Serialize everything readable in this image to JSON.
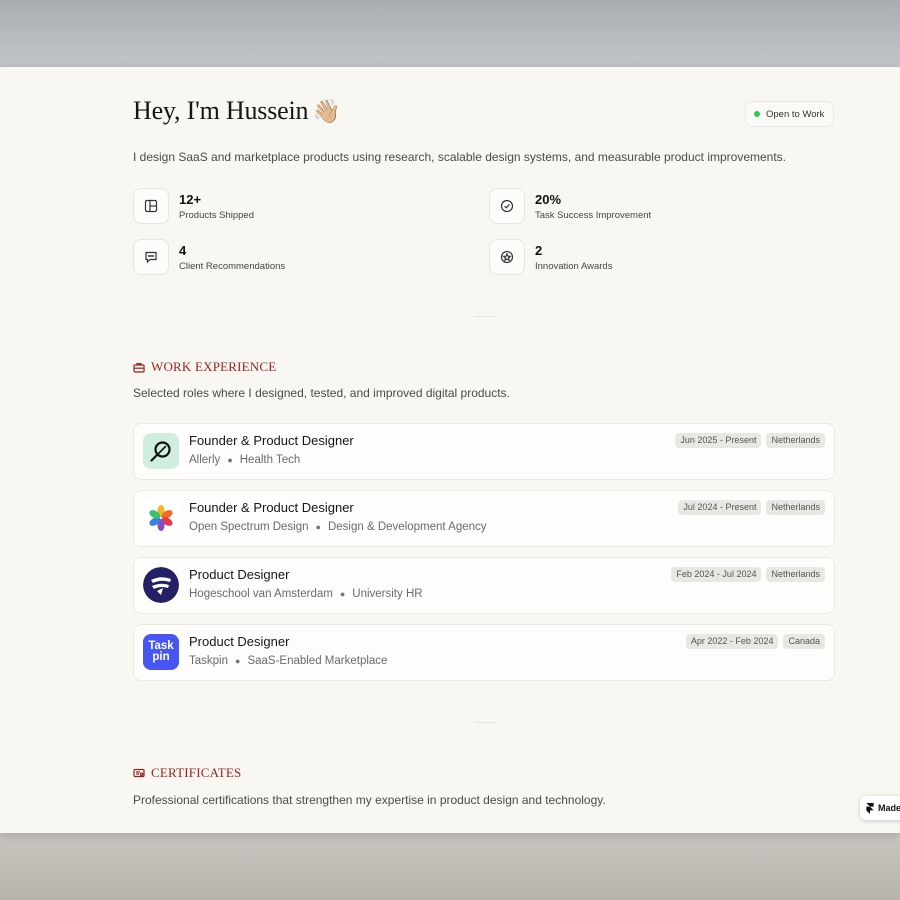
{
  "hero": {
    "greeting": "Hey, I'm Hussein",
    "emoji": "👋🏼",
    "status": "Open to Work",
    "intro": "I design SaaS and marketplace products using research, scalable design systems, and measurable product improvements."
  },
  "stats": [
    {
      "value": "12+",
      "label": "Products Shipped",
      "icon": "layout-icon"
    },
    {
      "value": "20%",
      "label": "Task Success Improvement",
      "icon": "check-circle-icon"
    },
    {
      "value": "4",
      "label": "Client Recommendations",
      "icon": "message-icon"
    },
    {
      "value": "2",
      "label": "Innovation Awards",
      "icon": "award-icon"
    }
  ],
  "work": {
    "heading": "WORK EXPERIENCE",
    "subtitle": "Selected roles where I designed, tested, and improved digital products.",
    "items": [
      {
        "role": "Founder & Product Designer",
        "company": "Allerly",
        "category": "Health Tech",
        "dates": "Jun 2025 - Present",
        "location": "Netherlands",
        "logo": "allerly-logo"
      },
      {
        "role": "Founder & Product Designer",
        "company": "Open Spectrum Design",
        "category": "Design & Development Agency",
        "dates": "Jul 2024 - Present",
        "location": "Netherlands",
        "logo": "open-spectrum-logo"
      },
      {
        "role": "Product Designer",
        "company": "Hogeschool van Amsterdam",
        "category": "University HR",
        "dates": "Feb 2024 - Jul 2024",
        "location": "Netherlands",
        "logo": "hva-logo"
      },
      {
        "role": "Product Designer",
        "company": "Taskpin",
        "category": "SaaS-Enabled Marketplace",
        "dates": "Apr 2022 - Feb 2024",
        "location": "Canada",
        "logo": "taskpin-logo",
        "logo_text": "Task pin"
      }
    ]
  },
  "certificates": {
    "heading": "CERTIFICATES",
    "subtitle": "Professional certifications that strengthen my expertise in product design and technology."
  },
  "badge": {
    "label": "Made"
  },
  "colors": {
    "accent": "#9a1f1f",
    "status_green": "#2ecb55",
    "page_bg": "#f9f7f2",
    "taskpin": "#4755f2",
    "hva": "#232066"
  }
}
